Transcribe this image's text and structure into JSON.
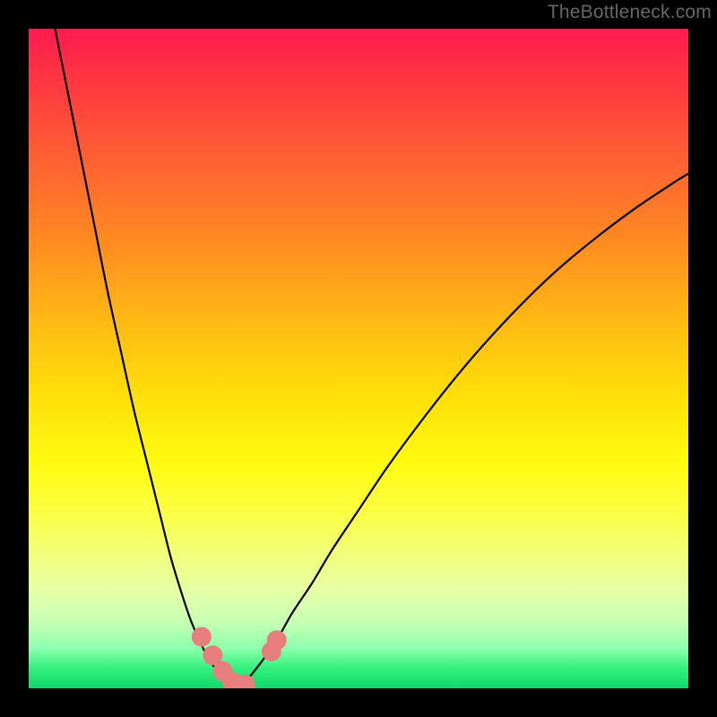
{
  "attribution": "TheBottleneck.com",
  "chart_data": {
    "type": "line",
    "title": "",
    "xlabel": "",
    "ylabel": "",
    "xlim": [
      0,
      100
    ],
    "ylim": [
      0,
      100
    ],
    "series": [
      {
        "name": "left-curve",
        "x": [
          4,
          6,
          8,
          10,
          12,
          14,
          16,
          18,
          20,
          21.5,
          23,
          24.5,
          26,
          27,
          28,
          29,
          30,
          30.8,
          31.5
        ],
        "y": [
          100,
          90,
          80,
          70,
          60,
          51,
          42,
          34,
          26,
          20,
          15,
          10.5,
          7,
          5,
          3.4,
          2.2,
          1.2,
          0.5,
          0
        ]
      },
      {
        "name": "right-curve",
        "x": [
          31.5,
          33,
          34.5,
          36,
          38,
          40,
          43,
          46,
          50,
          54,
          58,
          63,
          68,
          74,
          80,
          86,
          92,
          98,
          100
        ],
        "y": [
          0,
          1.2,
          3,
          5,
          8,
          11.5,
          16,
          21,
          27,
          33,
          38.5,
          45,
          51,
          57.5,
          63.3,
          68.3,
          72.8,
          76.8,
          78
        ]
      }
    ],
    "markers": {
      "name": "bottom-dots",
      "color": "#e77d7d",
      "points": [
        {
          "x": 26.2,
          "y": 7.8
        },
        {
          "x": 27.9,
          "y": 5.0
        },
        {
          "x": 29.4,
          "y": 2.6
        },
        {
          "x": 30.8,
          "y": 1.0
        },
        {
          "x": 32.8,
          "y": 0.6
        },
        {
          "x": 36.8,
          "y": 5.6
        },
        {
          "x": 37.6,
          "y": 7.3
        }
      ]
    }
  }
}
